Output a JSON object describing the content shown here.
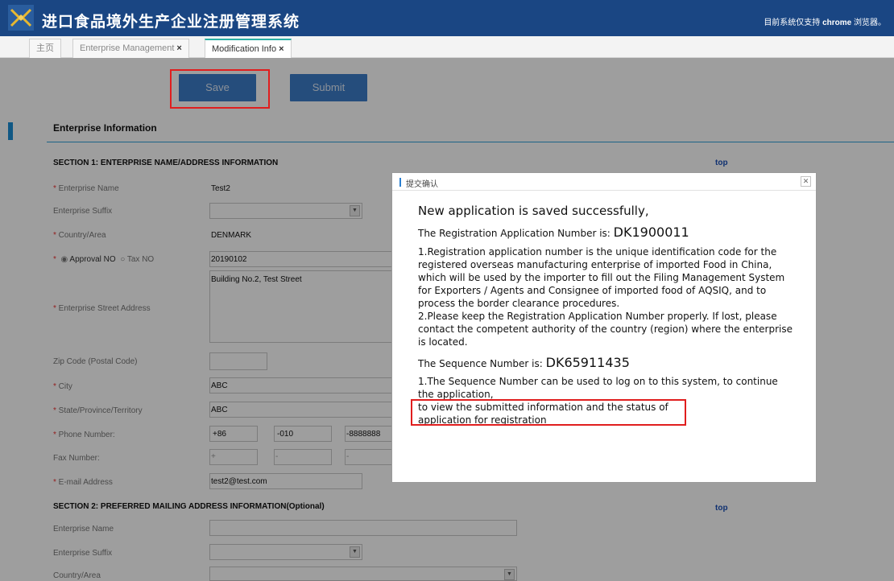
{
  "header": {
    "app_title": "进口食品境外生产企业注册管理系统",
    "browser_note_prefix": "目前系统仅支持",
    "browser_note_name": "chrome",
    "browser_note_suffix": "浏览器。"
  },
  "tabs": [
    {
      "label": "主页",
      "closable": false,
      "active": false
    },
    {
      "label": "Enterprise Management",
      "closable": true,
      "active": false
    },
    {
      "label": "Modification Info",
      "closable": true,
      "active": true
    }
  ],
  "tab_close_glyph": "×",
  "toolbar": {
    "save_label": "Save",
    "submit_label": "Submit"
  },
  "page": {
    "title": "Enterprise Information",
    "top_link": "top",
    "section1": {
      "heading": "SECTION 1: ENTERPRISE NAME/ADDRESS INFORMATION",
      "enterprise_name_label": "Enterprise Name",
      "enterprise_name_value": "Test2",
      "enterprise_suffix_label": "Enterprise Suffix",
      "country_label": "Country/Area",
      "country_value": "DENMARK",
      "approval_label": "Approval NO",
      "tax_label": "Tax NO",
      "approval_value": "20190102",
      "street_label": "Enterprise Street Address",
      "street_value": "Building No.2, Test Street",
      "zip_label": "Zip Code (Postal Code)",
      "city_label": "City",
      "city_value": "ABC",
      "state_label": "State/Province/Territory",
      "state_value": "ABC",
      "phone_label": "Phone Number:",
      "phone_country": "+86",
      "phone_area": "-010",
      "phone_number": "-8888888",
      "fax_label": "Fax Number:",
      "fax_country": "+",
      "fax_area": "-",
      "fax_number": "-",
      "email_label": "E-mail Address",
      "email_value": "test2@test.com"
    },
    "section2": {
      "heading": "SECTION 2: PREFERRED MAILING ADDRESS INFORMATION(Optional)",
      "enterprise_name_label": "Enterprise Name",
      "enterprise_suffix_label": "Enterprise Suffix",
      "country_label": "Country/Area"
    }
  },
  "dialog": {
    "title": "提交确认",
    "close_glyph": "✕",
    "saved_message": "New application is saved successfully,",
    "reg_prefix": "The Registration Application Number is:",
    "reg_number": "DK1900011",
    "para1": "1.Registration application number is the unique identification code for the registered overseas manufacturing enterprise of imported Food in China, which will be used by the importer to fill out the Filing Management System for Exporters / Agents and Consignee of imported food of AQSIQ, and to process the border clearance procedures.",
    "para2": "2.Please keep the Registration Application Number properly. If lost, please contact the competent authority of the country (region) where the enterprise is located.",
    "seq_prefix": "The Sequence Number is:",
    "seq_number": "DK65911435",
    "para3_line1": "1.The Sequence Number can be used to log on to this system, to continue the application,",
    "para3_line2": "to view the submitted information and the status of",
    "para3_line3": "application for registration"
  },
  "colors": {
    "header_bg": "#1a4683",
    "button_bg": "#3d7cc9",
    "highlight_red": "#e01e1e",
    "active_tab_accent": "#2bb0a4",
    "link": "#1a4fb6"
  }
}
